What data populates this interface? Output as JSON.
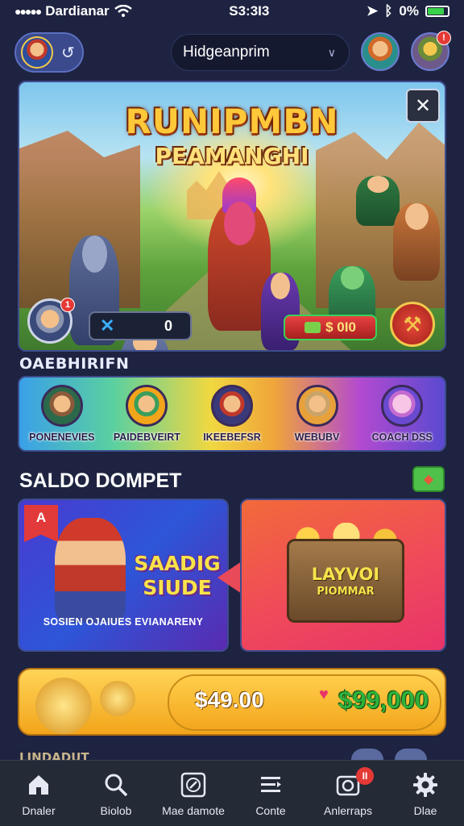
{
  "status_bar": {
    "carrier": "Dardianar",
    "time": "S3:3I3",
    "battery": "0%",
    "battery_level": 0.85
  },
  "top_bar": {
    "profile_arrow": "↺",
    "search_value": "Hidgeanprim",
    "notification_count": "!"
  },
  "hero": {
    "title_line1": "RUNIPMBN",
    "title_line2": "PEAMANGHI",
    "close_label": "✕",
    "left_counter_value": "0",
    "right_counter_value": "$ 0I0",
    "avatar_badge": "1"
  },
  "categories": {
    "section_label": "OAEBHIRIFN",
    "items": [
      {
        "label": "PONENEVIES",
        "icon": "character-icon"
      },
      {
        "label": "PAIDEBVEIRT",
        "icon": "elf-icon"
      },
      {
        "label": "IKEEBEFSR",
        "icon": "warrior-icon"
      },
      {
        "label": "WEBUBV",
        "icon": "dwarf-icon"
      },
      {
        "label": "COACH DSS",
        "icon": "glove-icon"
      }
    ]
  },
  "saldo": {
    "title": "SALDO DOMPET",
    "promo_left": {
      "badge": "A",
      "headline1": "SAADIG",
      "headline2": "SIUDE",
      "caption": "SOSIEN OJAIUES EVIANARENY"
    },
    "promo_right": {
      "headline": "LAYVOI",
      "subline": "PIOMMAR"
    }
  },
  "balance": {
    "amount_left": "$49.00",
    "amount_right": "$99,000"
  },
  "next_section": {
    "label": "LINDADUT"
  },
  "bottom_nav": [
    {
      "label": "Dnaler",
      "icon": "home-icon"
    },
    {
      "label": "Biolob",
      "icon": "search-icon"
    },
    {
      "label": "Mae damote",
      "icon": "compass-icon"
    },
    {
      "label": "Conte",
      "icon": "menu-icon"
    },
    {
      "label": "Anlerraps",
      "icon": "camera-icon",
      "badge": "II"
    },
    {
      "label": "Dlae",
      "icon": "gear-icon"
    }
  ],
  "colors": {
    "background": "#1d2340",
    "accent_gold": "#ffc83a",
    "nav_background": "#242a36",
    "badge_red": "#e53935"
  }
}
